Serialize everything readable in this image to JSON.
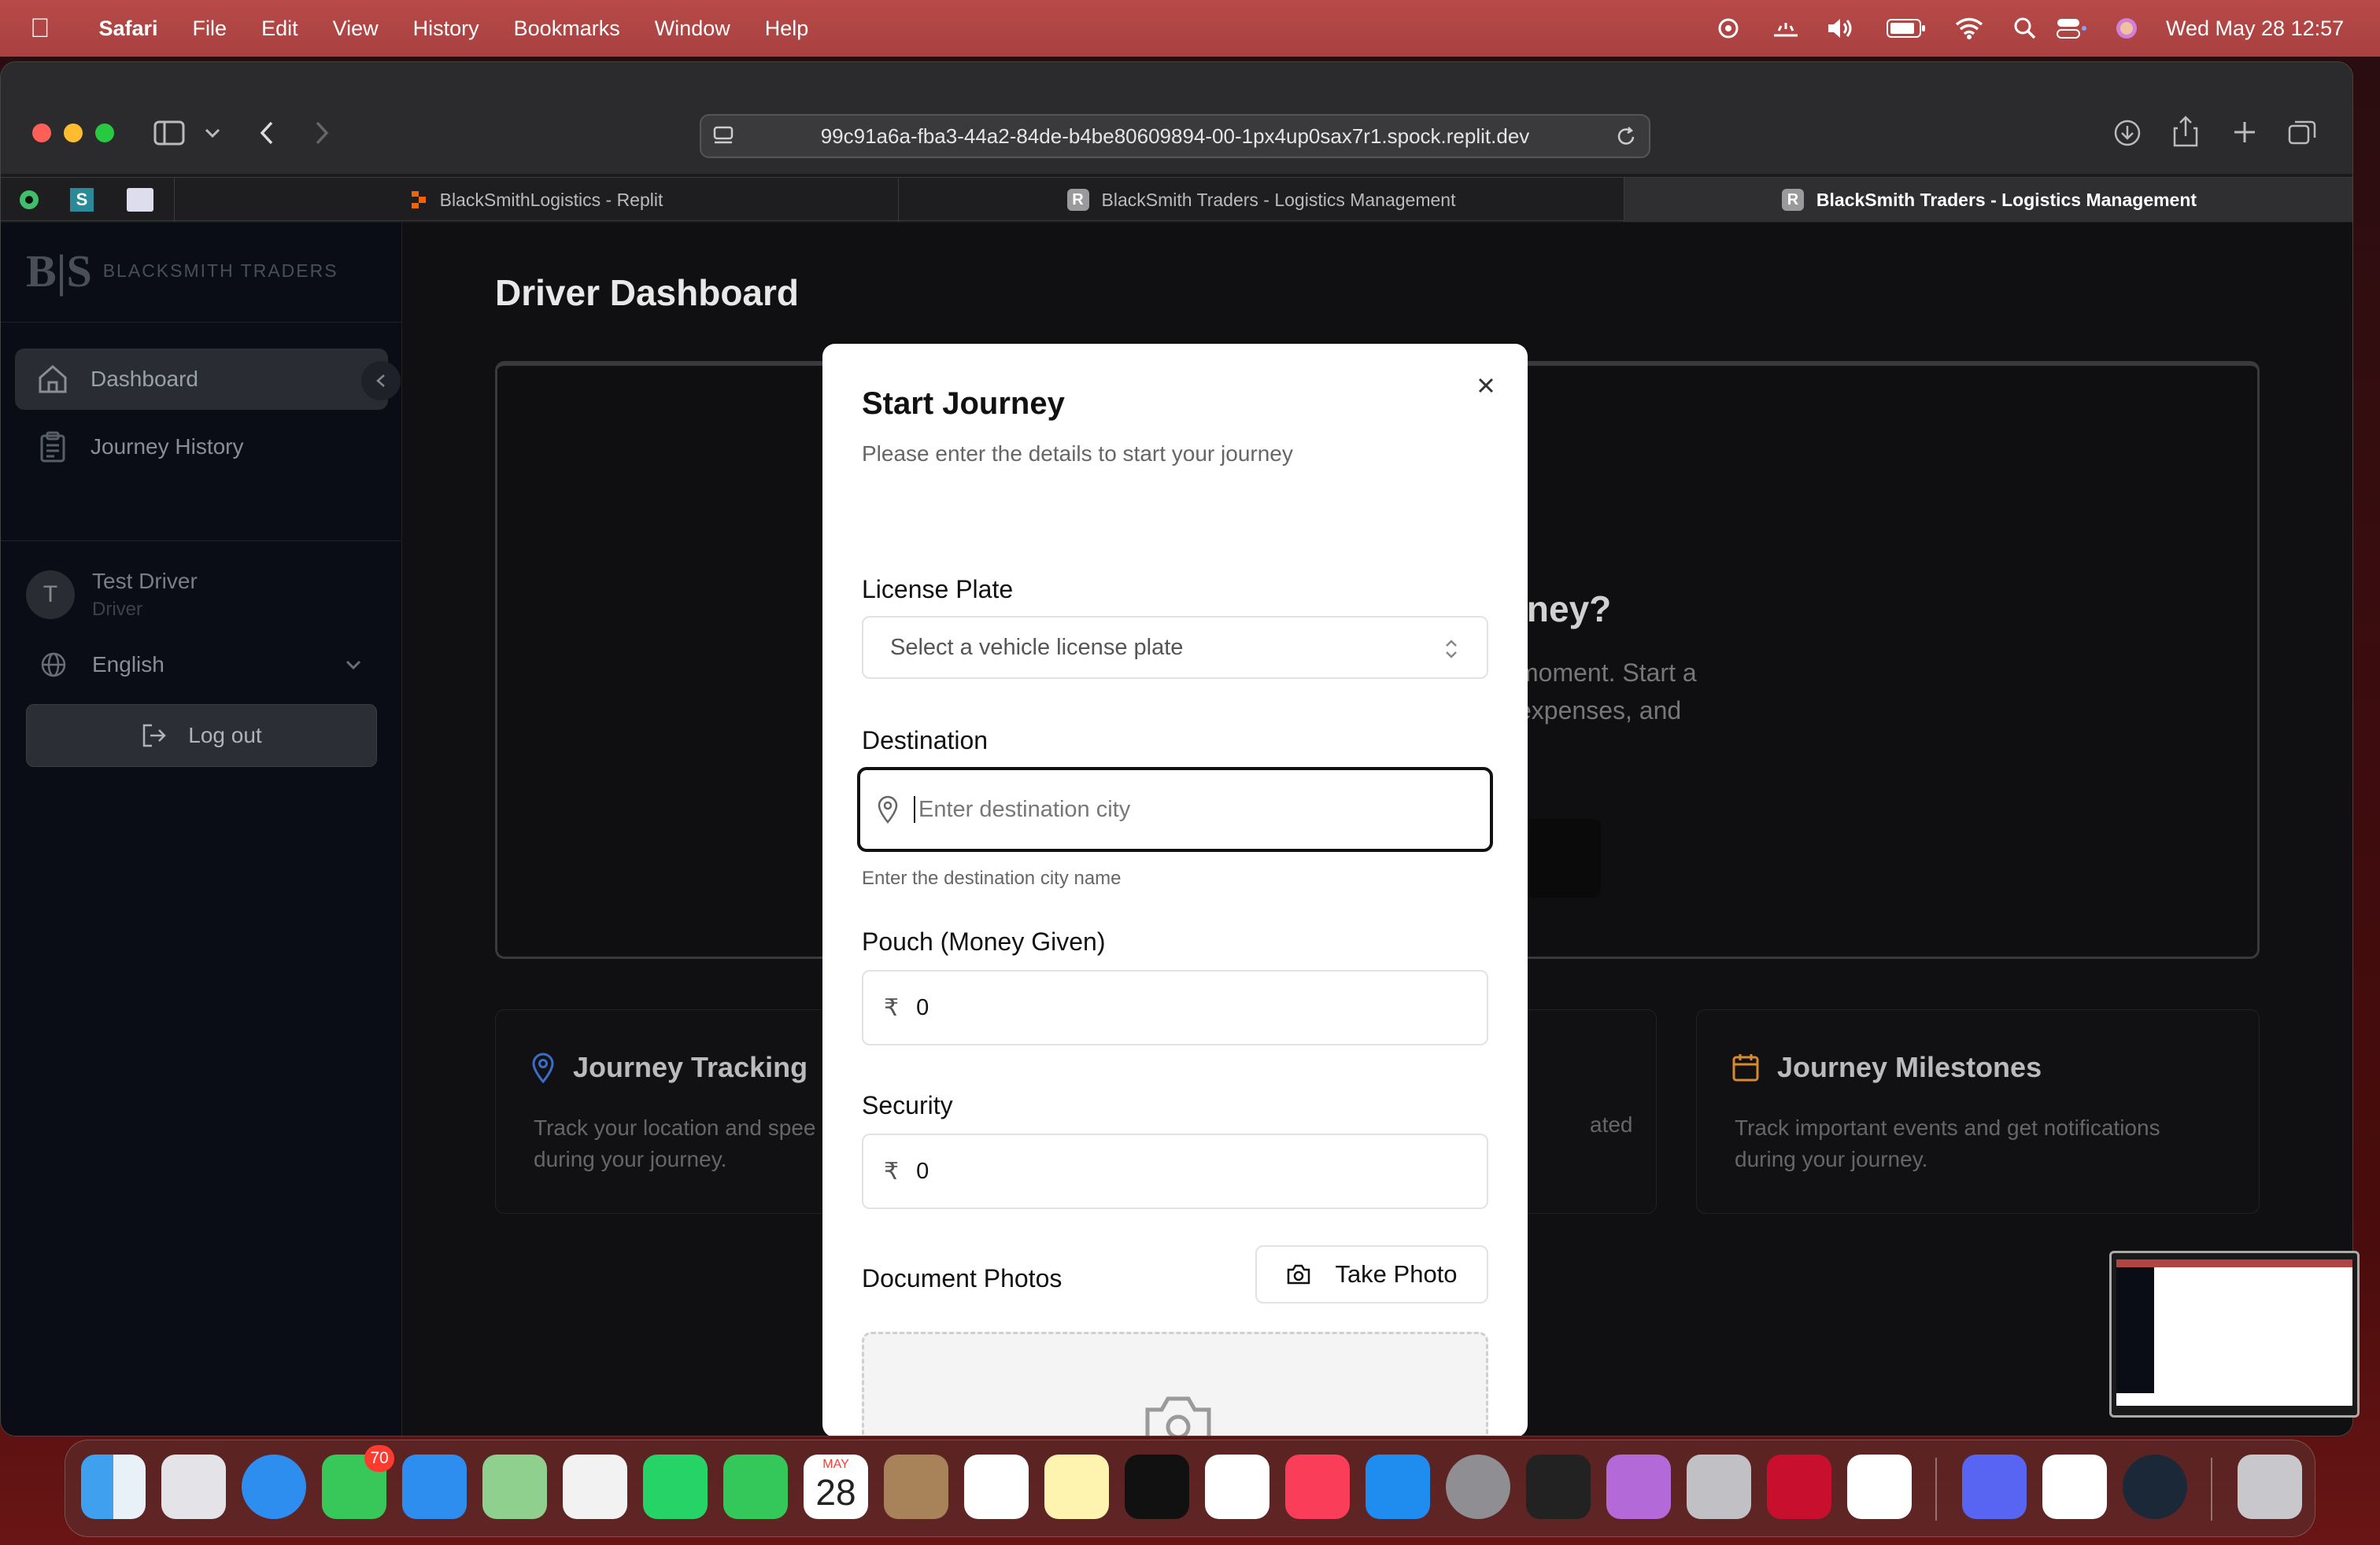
{
  "menubar": {
    "app_name": "Safari",
    "menus": [
      "File",
      "Edit",
      "View",
      "History",
      "Bookmarks",
      "Window",
      "Help"
    ],
    "clock": "Wed May 28  12:57"
  },
  "browser": {
    "url": "99c91a6a-fba3-44a2-84de-b4be80609894-00-1px4up0sax7r1.spock.replit.dev",
    "tabs": [
      {
        "label": "BlackSmithLogistics - Replit"
      },
      {
        "label": "BlackSmith Traders - Logistics Management"
      },
      {
        "label": "BlackSmith Traders - Logistics Management"
      }
    ]
  },
  "sidebar": {
    "logo_mark": "B|S",
    "logo_text": "BLACKSMITH TRADERS",
    "items": [
      {
        "label": "Dashboard"
      },
      {
        "label": "Journey History"
      }
    ],
    "user": {
      "initial": "T",
      "name": "Test Driver",
      "role": "Driver"
    },
    "language": "English",
    "logout_label": "Log out"
  },
  "page": {
    "title": "Driver Dashboard",
    "hero_heading_fragment": "rney?",
    "hero_text_1": "moment. Start a",
    "hero_text_2": "expenses, and",
    "cards": [
      {
        "title": "Journey Tracking",
        "text1": "Track your location and spee",
        "text2": "during your journey."
      },
      {
        "title": "",
        "text1": "ated",
        "text2": ""
      },
      {
        "title": "Journey Milestones",
        "text1": "Track important events and get notifications",
        "text2": "during your journey."
      }
    ]
  },
  "modal": {
    "title": "Start Journey",
    "subtitle": "Please enter the details to start your journey",
    "license_label": "License Plate",
    "license_placeholder": "Select a vehicle license plate",
    "destination_label": "Destination",
    "destination_placeholder": "Enter destination city",
    "destination_help": "Enter the destination city name",
    "pouch_label": "Pouch (Money Given)",
    "pouch_currency": "₹",
    "pouch_value": "0",
    "security_label": "Security",
    "security_currency": "₹",
    "security_value": "0",
    "photos_label": "Document Photos",
    "take_photo_label": "Take Photo"
  },
  "dock": {
    "messages_badge": "70",
    "calendar_month": "MAY",
    "calendar_day": "28"
  },
  "colors": {
    "menubar": "#b04543",
    "sidebar_bg": "#0a0d16",
    "modal_bg": "#ffffff",
    "accent_blue": "#3b6cc7",
    "milestone_orange": "#d98a2b"
  }
}
